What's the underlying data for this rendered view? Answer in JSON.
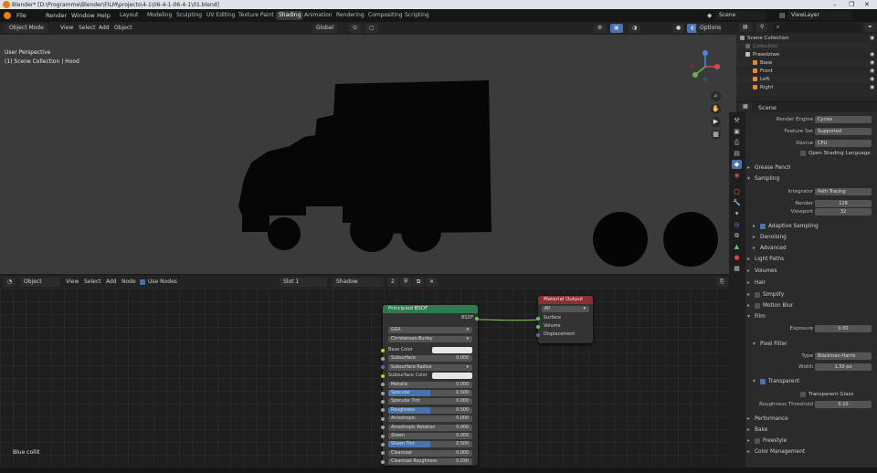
{
  "window": {
    "title": "Blender* [D:\\Programme\\Blender\\FILM\\projects\\4-1\\06-4-1-06-4-1\\01.blend]",
    "controls": [
      "–",
      "❐",
      "✕"
    ]
  },
  "menu": [
    "File",
    "Render",
    "Window",
    "Help"
  ],
  "workspaces": [
    "Layout",
    "Modeling",
    "Sculpting",
    "UV Editing",
    "Texture Paint",
    "Shading",
    "Animation",
    "Rendering",
    "Compositing",
    "Scripting"
  ],
  "active_workspace": "Shading",
  "scene": "Scene",
  "view_layer": "ViewLayer",
  "viewport": {
    "mode": "Object Mode",
    "menus": [
      "View",
      "Select",
      "Add",
      "Object"
    ],
    "orientation": "Global",
    "overlay_title": "User Perspective",
    "overlay_subtitle": "(1) Scene Collection | Hood",
    "options_label": "Options"
  },
  "node_editor": {
    "editor_type": "Object",
    "menus": [
      "View",
      "Select",
      "Add",
      "Node"
    ],
    "use_nodes_label": "Use Nodes",
    "slot": "Slot 1",
    "material": "Shadow",
    "frame_label": "Blue collit",
    "bsdf": {
      "title": "Principled BSDF",
      "output": "BSDF",
      "distribution": "GGX",
      "subsurface_method": "Christensen-Burley",
      "inputs": [
        {
          "label": "Base Color",
          "type": "color",
          "color": "#e6e6e6"
        },
        {
          "label": "Subsurface",
          "value": "0.000"
        },
        {
          "label": "Subsurface Radius",
          "type": "vector"
        },
        {
          "label": "Subsurface Color",
          "type": "color",
          "color": "#e6e6e6"
        },
        {
          "label": "Metallic",
          "value": "0.000"
        },
        {
          "label": "Specular",
          "value": "0.500",
          "fill": 0.5
        },
        {
          "label": "Specular Tint",
          "value": "0.000"
        },
        {
          "label": "Roughness",
          "value": "0.500",
          "fill": 0.5
        },
        {
          "label": "Anisotropic",
          "value": "0.000"
        },
        {
          "label": "Anisotropic Rotation",
          "value": "0.000"
        },
        {
          "label": "Sheen",
          "value": "0.000"
        },
        {
          "label": "Sheen Tint",
          "value": "0.500",
          "fill": 0.5
        },
        {
          "label": "Clearcoat",
          "value": "0.000"
        },
        {
          "label": "Clearcoat Roughness",
          "value": "0.030"
        }
      ]
    },
    "output": {
      "title": "Material Output",
      "target": "All",
      "inputs": [
        "Surface",
        "Volume",
        "Displacement"
      ]
    }
  },
  "outliner": {
    "rows": [
      "Scene Collection",
      "Collection",
      "Prawdziwe",
      "Base",
      "Front",
      "Left",
      "Right"
    ]
  },
  "properties": {
    "context": "Scene",
    "render_engine_label": "Render Engine",
    "render_engine": "Cycles",
    "feature_set_label": "Feature Set",
    "feature_set": "Supported",
    "device_label": "Device",
    "device": "CPU",
    "osl_label": "Open Shading Language",
    "sections": {
      "grease_pencil": "Grease Pencil",
      "sampling": "Sampling",
      "integrator_label": "Integrator",
      "integrator": "Path Tracing",
      "render_label": "Render",
      "render_value": "128",
      "viewport_label": "Viewport",
      "viewport_value": "32",
      "adaptive": "Adaptive Sampling",
      "denoising": "Denoising",
      "advanced": "Advanced",
      "light_paths": "Light Paths",
      "volumes": "Volumes",
      "hair": "Hair",
      "simplify": "Simplify",
      "motion_blur": "Motion Blur",
      "film": "Film",
      "exposure_label": "Exposure",
      "exposure": "0.00",
      "pixel_filter": "Pixel Filter",
      "type_label": "Type",
      "type": "Blackman-Harris",
      "width_label": "Width",
      "width": "1.50 px",
      "transparent": "Transparent",
      "transparent_glass": "Transparent Glass",
      "roughness_label": "Roughness Threshold",
      "roughness": "0.10",
      "performance": "Performance",
      "bake": "Bake",
      "freestyle": "Freestyle",
      "color_management": "Color Management"
    }
  },
  "colors": {
    "accent": "#4772b3",
    "bsdf_header": "#2f7a4f",
    "output_header": "#8a2f32",
    "viewport_bg": "#3b3b3b"
  }
}
